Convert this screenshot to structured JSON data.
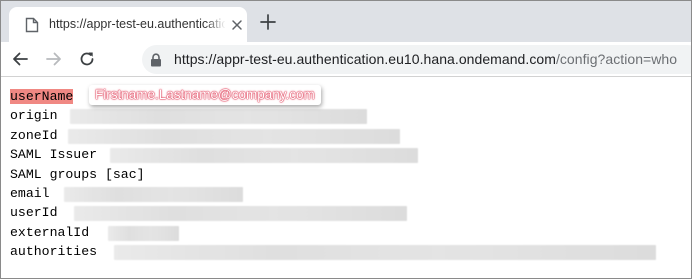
{
  "tab": {
    "title": "https://appr-test-eu.authenticatio"
  },
  "address_bar": {
    "host": "https://appr-test-eu.authentication.eu10.hana.ondemand.com",
    "path": "/config?action=who"
  },
  "annotation": {
    "text": "Firstname.Lastname@company.com"
  },
  "content": {
    "lines": [
      {
        "key": "userName"
      },
      {
        "key": "origin"
      },
      {
        "key": "zoneId"
      },
      {
        "key": "SAML Issuer"
      },
      {
        "key": "SAML groups [sac]"
      },
      {
        "key": "email"
      },
      {
        "key": "userId"
      },
      {
        "key": "externalId"
      },
      {
        "key": "authorities"
      }
    ]
  },
  "colors": {
    "tabstrip": "#dee1e6",
    "omnibox": "#f1f3f4",
    "highlight": "#f08883",
    "annotation": "#e0405a",
    "url_path": "#6c6f73"
  },
  "icons": [
    "page-icon",
    "close-icon",
    "plus-icon",
    "back-arrow-icon",
    "forward-arrow-icon",
    "reload-icon",
    "lock-icon"
  ]
}
